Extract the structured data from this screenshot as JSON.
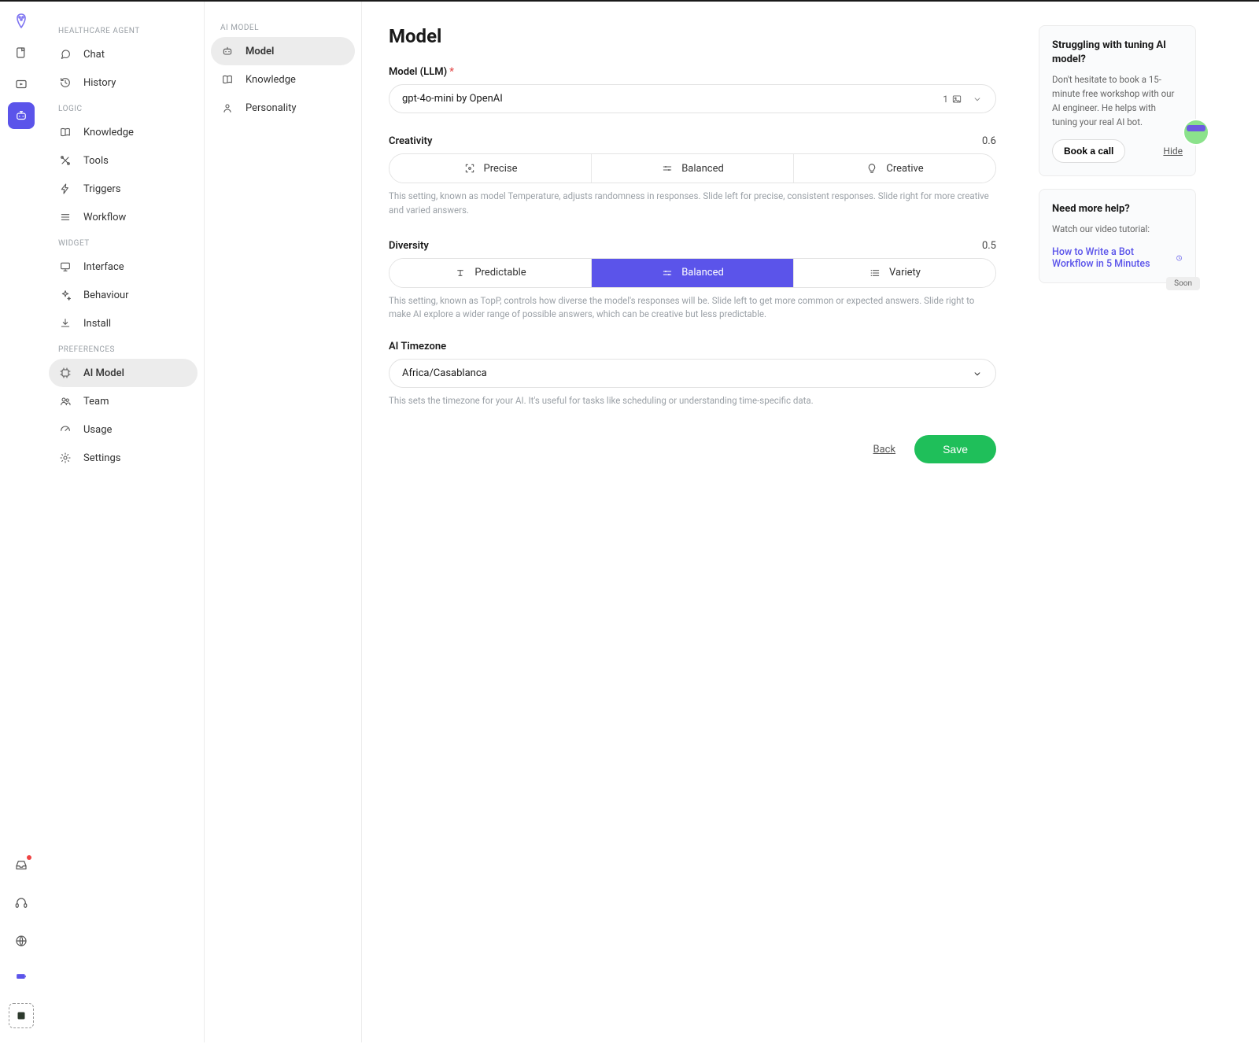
{
  "rail": {
    "active_index": 2
  },
  "sidebar": {
    "groups": [
      {
        "label": "HEALTHCARE AGENT",
        "items": [
          {
            "label": "Chat"
          },
          {
            "label": "History"
          }
        ]
      },
      {
        "label": "LOGIC",
        "items": [
          {
            "label": "Knowledge"
          },
          {
            "label": "Tools"
          },
          {
            "label": "Triggers"
          },
          {
            "label": "Workflow"
          }
        ]
      },
      {
        "label": "WIDGET",
        "items": [
          {
            "label": "Interface"
          },
          {
            "label": "Behaviour"
          },
          {
            "label": "Install"
          }
        ]
      },
      {
        "label": "PREFERENCES",
        "items": [
          {
            "label": "AI Model",
            "active": true
          },
          {
            "label": "Team"
          },
          {
            "label": "Usage"
          },
          {
            "label": "Settings"
          }
        ]
      }
    ]
  },
  "subsidebar": {
    "label": "AI MODEL",
    "items": [
      {
        "label": "Model",
        "active": true
      },
      {
        "label": "Knowledge"
      },
      {
        "label": "Personality"
      }
    ]
  },
  "main": {
    "title": "Model",
    "model_field": {
      "label": "Model (LLM)",
      "required": true,
      "value": "gpt-4o-mini by OpenAI",
      "badge_num": "1"
    },
    "creativity": {
      "label": "Creativity",
      "value": "0.6",
      "options": [
        {
          "label": "Precise"
        },
        {
          "label": "Balanced"
        },
        {
          "label": "Creative"
        }
      ],
      "active_index": -1,
      "helper": "This setting, known as model Temperature, adjusts randomness in responses. Slide left for precise, consistent responses. Slide right for more creative and varied answers."
    },
    "diversity": {
      "label": "Diversity",
      "value": "0.5",
      "options": [
        {
          "label": "Predictable"
        },
        {
          "label": "Balanced"
        },
        {
          "label": "Variety"
        }
      ],
      "active_index": 1,
      "helper": "This setting, known as TopP, controls how diverse the model's responses will be. Slide left to get more common or expected answers. Slide right to make AI explore a wider range of possible answers, which can be creative but less predictable."
    },
    "timezone": {
      "label": "AI Timezone",
      "value": "Africa/Casablanca",
      "helper": "This sets the timezone for your AI. It's useful for tasks like scheduling or understanding time-specific data."
    },
    "actions": {
      "back": "Back",
      "save": "Save"
    }
  },
  "rightcol": {
    "card1": {
      "title": "Struggling with tuning AI model?",
      "body": "Don't hesitate to book a 15-minute free workshop with our AI engineer. He helps with tuning your real AI bot.",
      "cta": "Book a call",
      "hide": "Hide"
    },
    "card2": {
      "title": "Need more help?",
      "body": "Watch our video tutorial:",
      "link": "How to Write a Bot Workflow in 5 Minutes",
      "soon": "Soon"
    }
  }
}
